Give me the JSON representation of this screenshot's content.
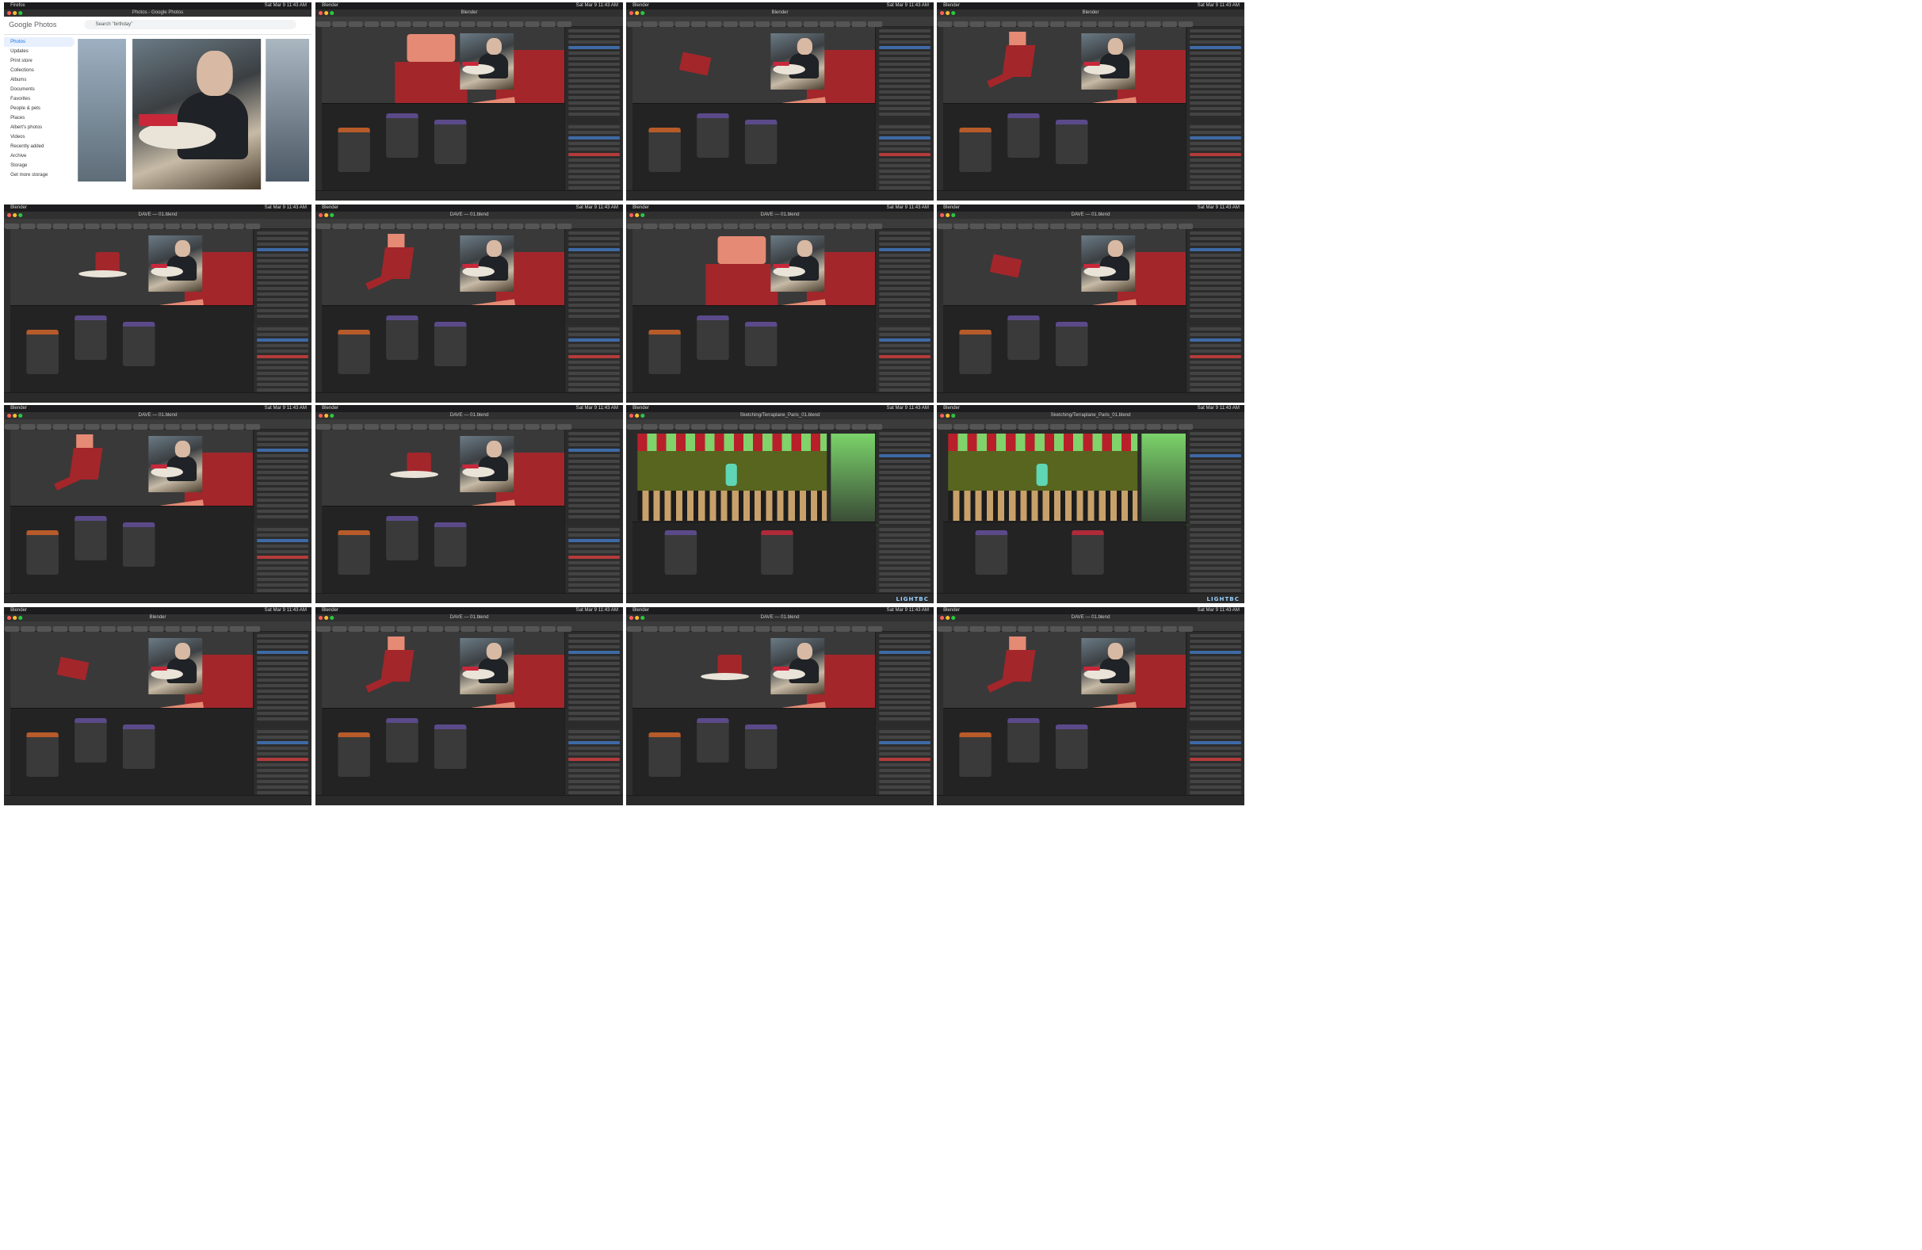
{
  "tiles": [
    {
      "app": "Firefox",
      "title": "Photos - Google Photos",
      "kind": "google-photos",
      "url": "photos.google.com",
      "search_placeholder": "Search \"birthday\"",
      "logo": "Google Photos",
      "sidebar": [
        "Photos",
        "Updates",
        "Print store",
        "Collections",
        "Albums",
        "Documents",
        "Favorites",
        "People & pets",
        "Places",
        "Albert's photos",
        "Videos",
        "Recently added",
        "Archive",
        "Storage",
        "Get more storage"
      ]
    },
    {
      "app": "Blender",
      "title": "Blender",
      "kind": "blender"
    },
    {
      "app": "Blender",
      "title": "Blender",
      "kind": "blender"
    },
    {
      "app": "Blender",
      "title": "Blender",
      "kind": "blender"
    },
    {
      "app": "Blender",
      "title": "DAVE — 01.blend",
      "kind": "blender"
    },
    {
      "app": "Blender",
      "title": "DAVE — 01.blend",
      "kind": "blender"
    },
    {
      "app": "Blender",
      "title": "DAVE — 01.blend",
      "kind": "blender"
    },
    {
      "app": "Blender",
      "title": "DAVE — 01.blend",
      "kind": "blender"
    },
    {
      "app": "Blender",
      "title": "DAVE — 01.blend",
      "kind": "blender"
    },
    {
      "app": "Blender",
      "title": "DAVE — 01.blend",
      "kind": "blender"
    },
    {
      "app": "Blender",
      "title": "Sketching/Terraplane_Paris_01.blend",
      "kind": "compositor",
      "badge": "LIGHTBC"
    },
    {
      "app": "Blender",
      "title": "Sketching/Terraplane_Paris_01.blend",
      "kind": "compositor",
      "badge": "LIGHTBC"
    },
    {
      "app": "Blender",
      "title": "Blender",
      "kind": "blender"
    },
    {
      "app": "Blender",
      "title": "DAVE — 01.blend",
      "kind": "blender"
    },
    {
      "app": "Blender",
      "title": "DAVE — 01.blend",
      "kind": "blender"
    },
    {
      "app": "Blender",
      "title": "DAVE — 01.blend",
      "kind": "blender"
    }
  ],
  "menubar_blender": [
    "Blender",
    "Window"
  ],
  "menubar_firefox": [
    "Firefox",
    "File",
    "Edit",
    "View",
    "History",
    "Bookmarks",
    "Profiles",
    "Tools",
    "Window",
    "Help"
  ],
  "clock": "Sat Mar 9 11:43 AM",
  "colors": {
    "model_red": "#a3262b",
    "model_pink": "#e58a74",
    "selection": "#3e6aa5",
    "node_purple": "#5b4a8a"
  }
}
